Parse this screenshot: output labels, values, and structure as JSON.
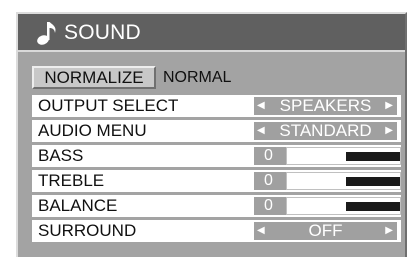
{
  "header": {
    "title": "SOUND",
    "icon": "music-note-icon"
  },
  "normalize": {
    "button_label": "NORMALIZE",
    "status": "NORMAL"
  },
  "rows": [
    {
      "label": "OUTPUT SELECT",
      "kind": "select",
      "value": "SPEAKERS"
    },
    {
      "label": "AUDIO MENU",
      "kind": "select",
      "value": "STANDARD"
    },
    {
      "label": "BASS",
      "kind": "slider",
      "value": "0"
    },
    {
      "label": "TREBLE",
      "kind": "slider",
      "value": "0"
    },
    {
      "label": "BALANCE",
      "kind": "slider",
      "value": "0"
    },
    {
      "label": "SURROUND",
      "kind": "select",
      "value": "OFF"
    }
  ],
  "colors": {
    "panel": "#a3a3a3",
    "titlebar": "#606060",
    "value_box": "#a0a0a0",
    "slider_fill": "#1a1a1a"
  }
}
